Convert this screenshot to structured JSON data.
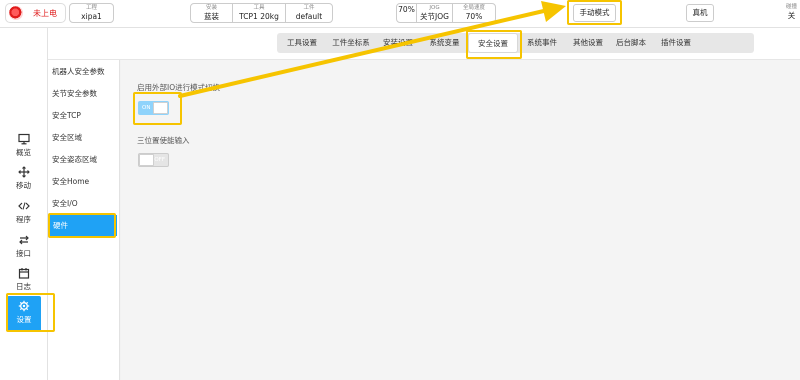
{
  "topbar": {
    "power_label": "未上电",
    "project_label": "工程",
    "project_value": "xipa1",
    "info_group_1": [
      {
        "label": "安装",
        "value": "蓝装"
      },
      {
        "label": "工具",
        "value": "TCP1 20kg"
      },
      {
        "label": "工件",
        "value": "default"
      }
    ],
    "info_group_2": [
      {
        "label": "",
        "value": "70%"
      },
      {
        "label": "JOG",
        "value": "关节JOG"
      },
      {
        "label": "全局速度",
        "value": "70%"
      }
    ],
    "manual_mode_label": "手动模式",
    "real_machine_label": "真机",
    "corner_label": "碰撞",
    "corner_value": "关"
  },
  "tabs": [
    "工具设置",
    "工件坐标系",
    "安装设置",
    "系统变量",
    "安全设置",
    "系统事件",
    "其他设置",
    "后台脚本",
    "插件设置"
  ],
  "active_tab": "安全设置",
  "leftnav": [
    {
      "label": "概览",
      "icon": "monitor-icon"
    },
    {
      "label": "移动",
      "icon": "move-icon"
    },
    {
      "label": "程序",
      "icon": "code-icon"
    },
    {
      "label": "接口",
      "icon": "swap-icon"
    },
    {
      "label": "日志",
      "icon": "calendar-icon"
    },
    {
      "label": "设置",
      "icon": "gear-icon"
    }
  ],
  "subnav": [
    "机器人安全参数",
    "关节安全参数",
    "安全TCP",
    "安全区域",
    "安全姿态区域",
    "安全Home",
    "安全I/O",
    "硬件"
  ],
  "settings": {
    "external_io_label": "启用外部IO进行模式切换",
    "external_io_state": "ON",
    "three_pos_label": "三位置使能输入",
    "three_pos_state": "OFF"
  },
  "colors": {
    "accent": "#1fa2f5",
    "highlight": "#f6c400",
    "power_red": "#e02020"
  }
}
